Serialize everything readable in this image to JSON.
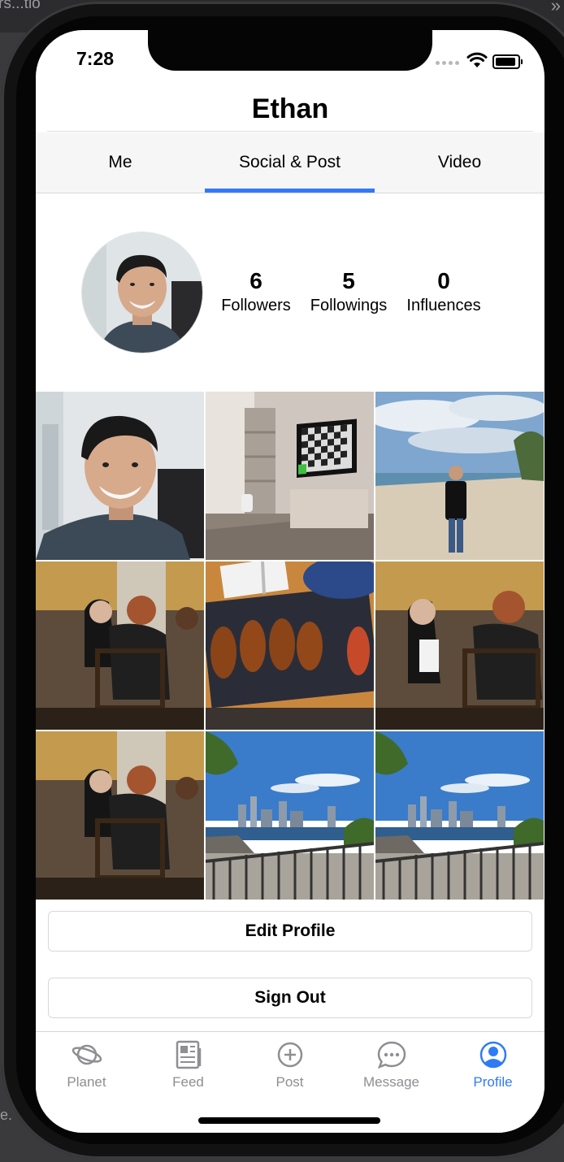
{
  "background": {
    "top_text": "rs...tio",
    "chevron": "»",
    "side_text": "e."
  },
  "status_bar": {
    "time": "7:28"
  },
  "nav": {
    "title": "Ethan"
  },
  "tabs": [
    {
      "label": "Me"
    },
    {
      "label": "Social & Post",
      "selected": true
    },
    {
      "label": "Video"
    }
  ],
  "profile": {
    "stats": [
      {
        "value": "6",
        "label": "Followers"
      },
      {
        "value": "5",
        "label": "Followings"
      },
      {
        "value": "0",
        "label": "Influences"
      }
    ]
  },
  "photos": [
    {
      "subject": "selfie"
    },
    {
      "subject": "room-with-tv"
    },
    {
      "subject": "beach"
    },
    {
      "subject": "cafe-friends"
    },
    {
      "subject": "food-plate"
    },
    {
      "subject": "cafe-friends"
    },
    {
      "subject": "cafe-friends"
    },
    {
      "subject": "city-skyline"
    },
    {
      "subject": "city-skyline"
    }
  ],
  "actions": {
    "edit_profile": "Edit Profile",
    "sign_out": "Sign Out"
  },
  "tab_bar": [
    {
      "label": "Planet",
      "icon": "planet-icon"
    },
    {
      "label": "Feed",
      "icon": "feed-icon"
    },
    {
      "label": "Post",
      "icon": "plus-circle-icon"
    },
    {
      "label": "Message",
      "icon": "message-icon"
    },
    {
      "label": "Profile",
      "icon": "profile-icon",
      "active": true
    }
  ],
  "colors": {
    "accent": "#3478f6",
    "inactive": "#8e8e93"
  }
}
